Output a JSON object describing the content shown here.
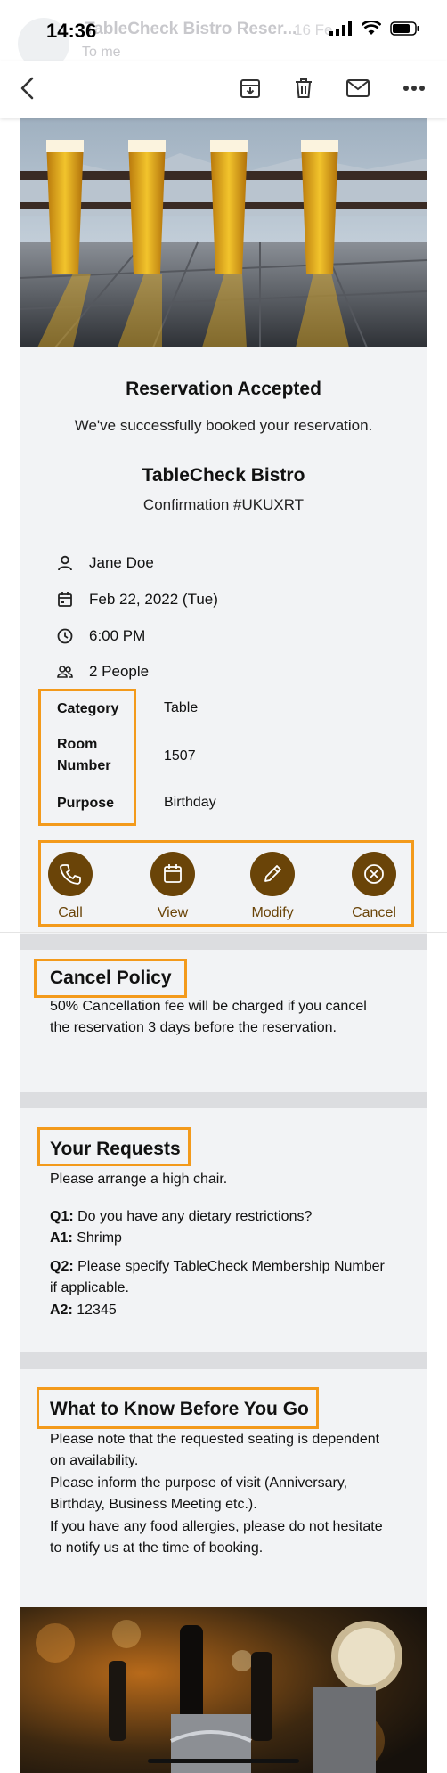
{
  "status": {
    "time": "14:36"
  },
  "header_ghost": {
    "sender": "TableCheck Bistro Reser...",
    "to": "To me",
    "date": "16 Fe"
  },
  "toolbar": {
    "back_icon": "chevron-left-icon",
    "archive_icon": "archive-icon",
    "delete_icon": "trash-icon",
    "mail_icon": "envelope-icon",
    "more_icon": "ellipsis-icon"
  },
  "reservation": {
    "heading": "Reservation Accepted",
    "subheading": "We've successfully booked your reservation.",
    "restaurant": "TableCheck Bistro",
    "confirmation": "Confirmation #UKUXRT",
    "guest_name": "Jane Doe",
    "date": "Feb 22, 2022 (Tue)",
    "time": "6:00 PM",
    "party": "2 People",
    "details": [
      {
        "label": "Category",
        "value": "Table"
      },
      {
        "label": "Room Number",
        "value": "1507"
      },
      {
        "label": "Purpose",
        "value": "Birthday"
      }
    ]
  },
  "actions": [
    {
      "label": "Call",
      "icon": "phone-icon"
    },
    {
      "label": "View",
      "icon": "calendar-icon"
    },
    {
      "label": "Modify",
      "icon": "pencil-icon"
    },
    {
      "label": "Cancel",
      "icon": "cancel-circle-icon"
    }
  ],
  "cancel_policy": {
    "title": "Cancel Policy",
    "body": "50% Cancellation fee will be charged if you cancel the reservation 3 days before the reservation."
  },
  "requests": {
    "title": "Your Requests",
    "note": "Please arrange a high chair.",
    "q1_label": "Q1:",
    "q1": "Do you have any dietary restrictions?",
    "a1_label": "A1:",
    "a1": "Shrimp",
    "q2_label": "Q2:",
    "q2": "Please specify TableCheck Membership Number if applicable.",
    "a2_label": "A2:",
    "a2": "12345"
  },
  "know_before": {
    "title": "What to Know Before You Go",
    "lines": [
      "Please note that the requested seating is dependent on availability.",
      "Please inform the purpose of visit (Anniversary, Birthday, Business Meeting etc.).",
      "If you have any food allergies, please do not hesitate to notify us at the time of booking."
    ]
  },
  "colors": {
    "accent_brown": "#6a4408",
    "highlight_orange": "#f39a1b"
  }
}
